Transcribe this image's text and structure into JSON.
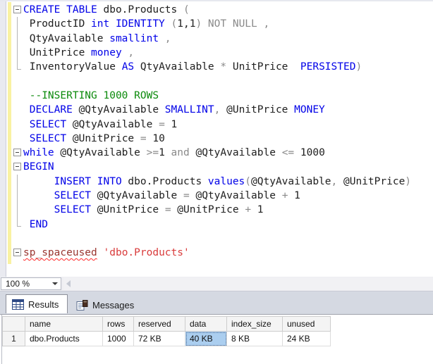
{
  "colors": {
    "keyword": "#0000E8",
    "identifier": "#202020",
    "operator_gray": "#8A8A8A",
    "comment_green": "#0B8A0B",
    "string_red": "#D93B3B",
    "system_proc_maroon": "#9A352F",
    "squiggle_red": "#FF2A2A",
    "change_tracking_yellow": "#F9F2A2",
    "selected_cell_blue": "#ABCEEF"
  },
  "editor": {
    "lines": [
      {
        "fold": "minus",
        "tokens": [
          [
            "k",
            "CREATE TABLE"
          ],
          [
            "i",
            " dbo.Products "
          ],
          [
            "g",
            "("
          ]
        ]
      },
      {
        "fold": "vline",
        "tokens": [
          [
            "i",
            " ProductID "
          ],
          [
            "k",
            "int IDENTITY"
          ],
          [
            "g",
            " ("
          ],
          [
            "i",
            "1,1"
          ],
          [
            "g",
            ") NOT NULL ,"
          ]
        ]
      },
      {
        "fold": "vline",
        "tokens": [
          [
            "i",
            " QtyAvailable "
          ],
          [
            "k",
            "smallint"
          ],
          [
            "g",
            " ,"
          ]
        ]
      },
      {
        "fold": "vline",
        "tokens": [
          [
            "i",
            " UnitPrice "
          ],
          [
            "k",
            "money"
          ],
          [
            "g",
            " ,"
          ]
        ]
      },
      {
        "fold": "end",
        "tokens": [
          [
            "i",
            " InventoryValue "
          ],
          [
            "k",
            "AS"
          ],
          [
            "i",
            " QtyAvailable "
          ],
          [
            "g",
            "*"
          ],
          [
            "i",
            " UnitPrice  "
          ],
          [
            "k",
            "PERSISTED"
          ],
          [
            "g",
            ")"
          ]
        ]
      },
      {
        "fold": "none",
        "tokens": []
      },
      {
        "fold": "none",
        "tokens": [
          [
            "c",
            " --INSERTING 1000 ROWS"
          ]
        ]
      },
      {
        "fold": "none",
        "tokens": [
          [
            "i",
            " "
          ],
          [
            "k",
            "DECLARE"
          ],
          [
            "i",
            " @QtyAvailable "
          ],
          [
            "k",
            "SMALLINT"
          ],
          [
            "g",
            ","
          ],
          [
            "i",
            " @UnitPrice "
          ],
          [
            "k",
            "MONEY"
          ]
        ]
      },
      {
        "fold": "none",
        "tokens": [
          [
            "i",
            " "
          ],
          [
            "k",
            "SELECT"
          ],
          [
            "i",
            " @QtyAvailable "
          ],
          [
            "g",
            "="
          ],
          [
            "i",
            " 1"
          ]
        ]
      },
      {
        "fold": "none",
        "tokens": [
          [
            "i",
            " "
          ],
          [
            "k",
            "SELECT"
          ],
          [
            "i",
            " @UnitPrice "
          ],
          [
            "g",
            "="
          ],
          [
            "i",
            " 10"
          ]
        ]
      },
      {
        "fold": "minus",
        "tokens": [
          [
            "k",
            "while"
          ],
          [
            "i",
            " @QtyAvailable "
          ],
          [
            "g",
            ">="
          ],
          [
            "i",
            "1 "
          ],
          [
            "g",
            "and"
          ],
          [
            "i",
            " @QtyAvailable "
          ],
          [
            "g",
            "<="
          ],
          [
            "i",
            " 1000"
          ]
        ]
      },
      {
        "fold": "minus",
        "tokens": [
          [
            "k",
            "BEGIN"
          ]
        ]
      },
      {
        "fold": "vline",
        "tokens": [
          [
            "i",
            "     "
          ],
          [
            "k",
            "INSERT INTO"
          ],
          [
            "i",
            " dbo.Products "
          ],
          [
            "k",
            "values"
          ],
          [
            "g",
            "("
          ],
          [
            "i",
            "@QtyAvailable"
          ],
          [
            "g",
            ","
          ],
          [
            "i",
            " @UnitPrice"
          ],
          [
            "g",
            ")"
          ]
        ]
      },
      {
        "fold": "vline",
        "tokens": [
          [
            "i",
            "     "
          ],
          [
            "k",
            "SELECT"
          ],
          [
            "i",
            " @QtyAvailable "
          ],
          [
            "g",
            "="
          ],
          [
            "i",
            " @QtyAvailable "
          ],
          [
            "g",
            "+"
          ],
          [
            "i",
            " 1"
          ]
        ]
      },
      {
        "fold": "vline",
        "tokens": [
          [
            "i",
            "     "
          ],
          [
            "k",
            "SELECT"
          ],
          [
            "i",
            " @UnitPrice "
          ],
          [
            "g",
            "="
          ],
          [
            "i",
            " @UnitPrice "
          ],
          [
            "g",
            "+"
          ],
          [
            "i",
            " 1"
          ]
        ]
      },
      {
        "fold": "end",
        "tokens": [
          [
            "i",
            " "
          ],
          [
            "k",
            "END"
          ]
        ]
      },
      {
        "fold": "none",
        "tokens": []
      },
      {
        "fold": "minus",
        "tokens": [
          [
            "m",
            "sp_spaceused"
          ],
          [
            "i",
            " "
          ],
          [
            "s",
            "'dbo.Products'"
          ]
        ]
      }
    ]
  },
  "statusbar": {
    "zoom_level": "100 %"
  },
  "results_pane": {
    "tabs": [
      {
        "label": "Results",
        "icon": "results-grid-icon",
        "active": true
      },
      {
        "label": "Messages",
        "icon": "messages-icon",
        "active": false
      }
    ]
  },
  "results_grid": {
    "columns": [
      "name",
      "rows",
      "reserved",
      "data",
      "index_size",
      "unused"
    ],
    "rows": [
      {
        "num": "1",
        "cells": [
          "dbo.Products",
          "1000",
          "72 KB",
          "40 KB",
          "8 KB",
          "24 KB"
        ]
      }
    ],
    "selected": {
      "row": 0,
      "column": "data",
      "value": "40 KB"
    }
  }
}
